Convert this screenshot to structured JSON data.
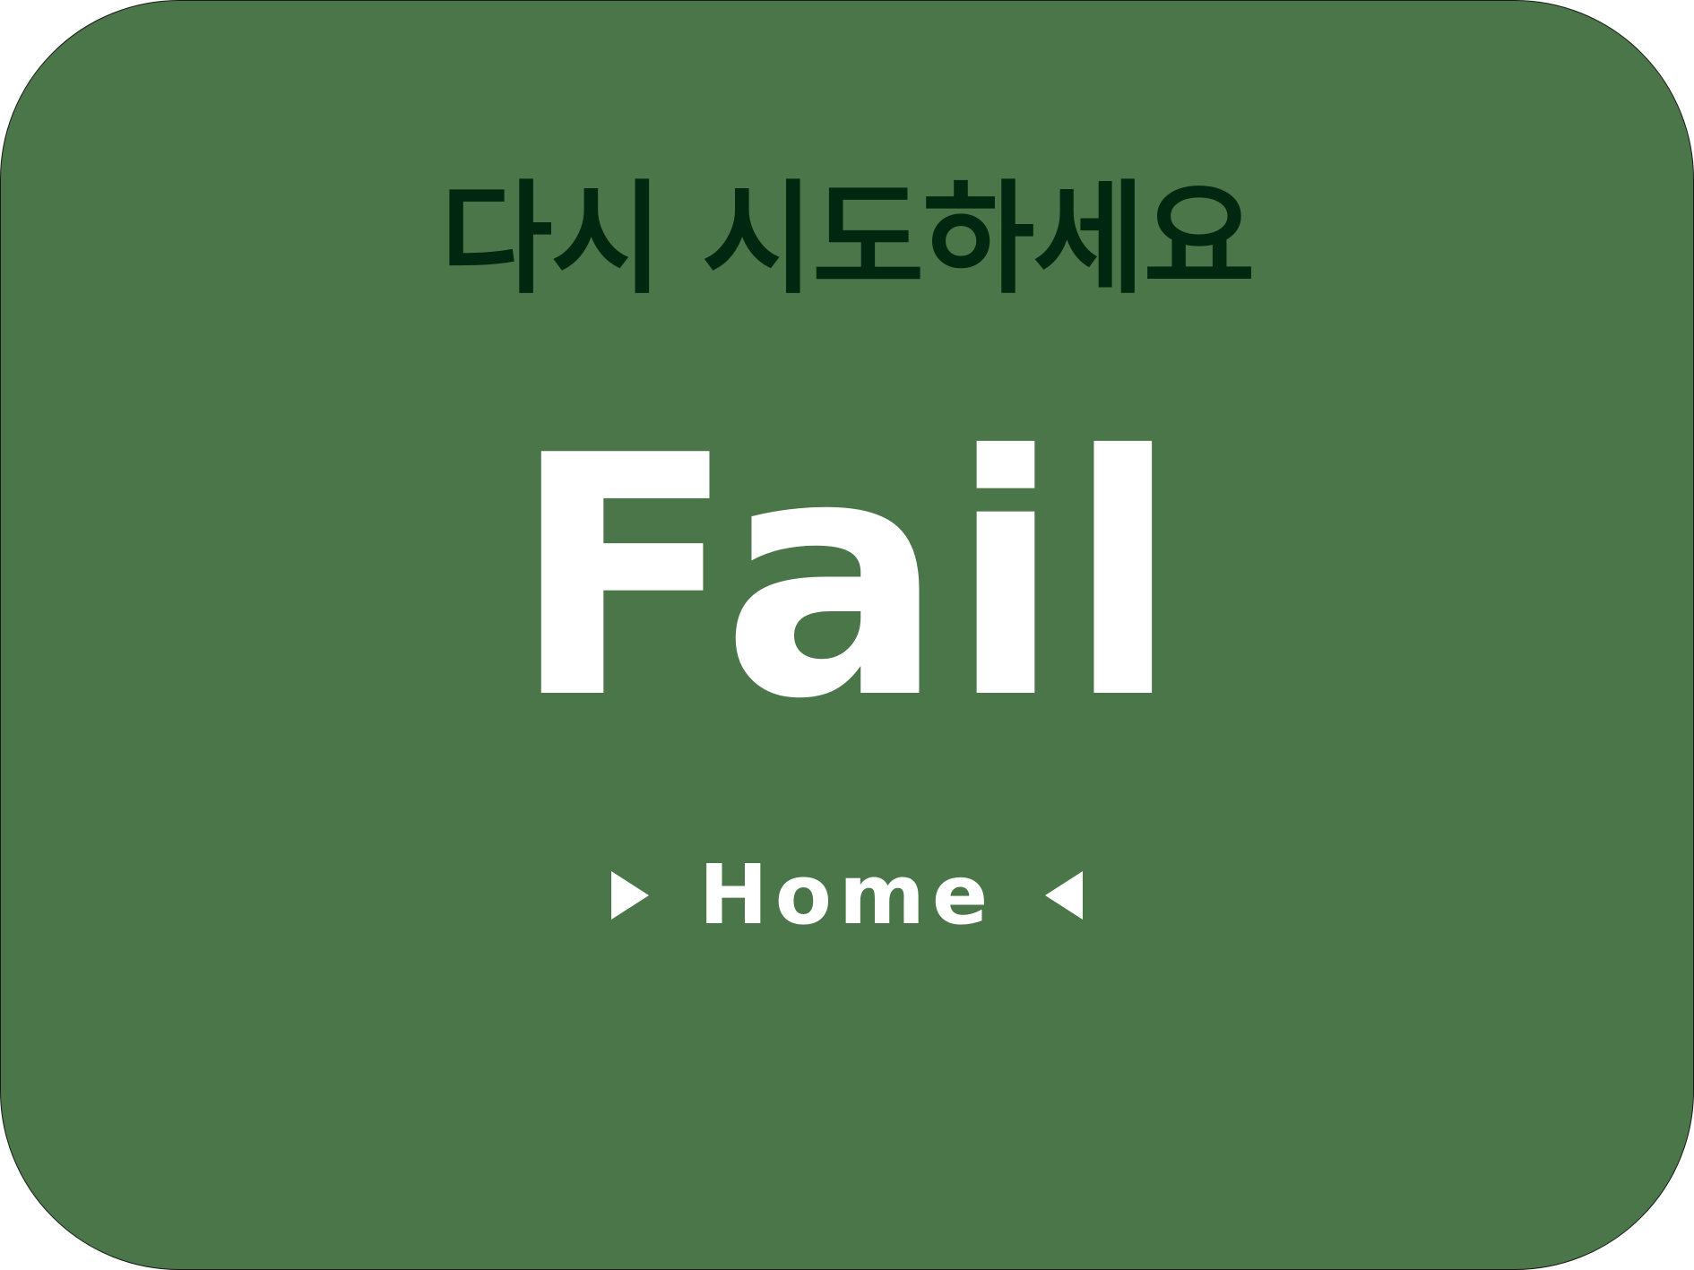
{
  "screen": {
    "subtitle": "다시 시도하세요",
    "title": "Fail"
  },
  "home_button": {
    "label": "Home",
    "left_icon": "play-right-icon",
    "right_icon": "play-left-icon"
  },
  "colors": {
    "panel_background": "#4a7649",
    "subtitle_text": "#022710",
    "title_text": "#ffffff",
    "button_text": "#ffffff"
  }
}
